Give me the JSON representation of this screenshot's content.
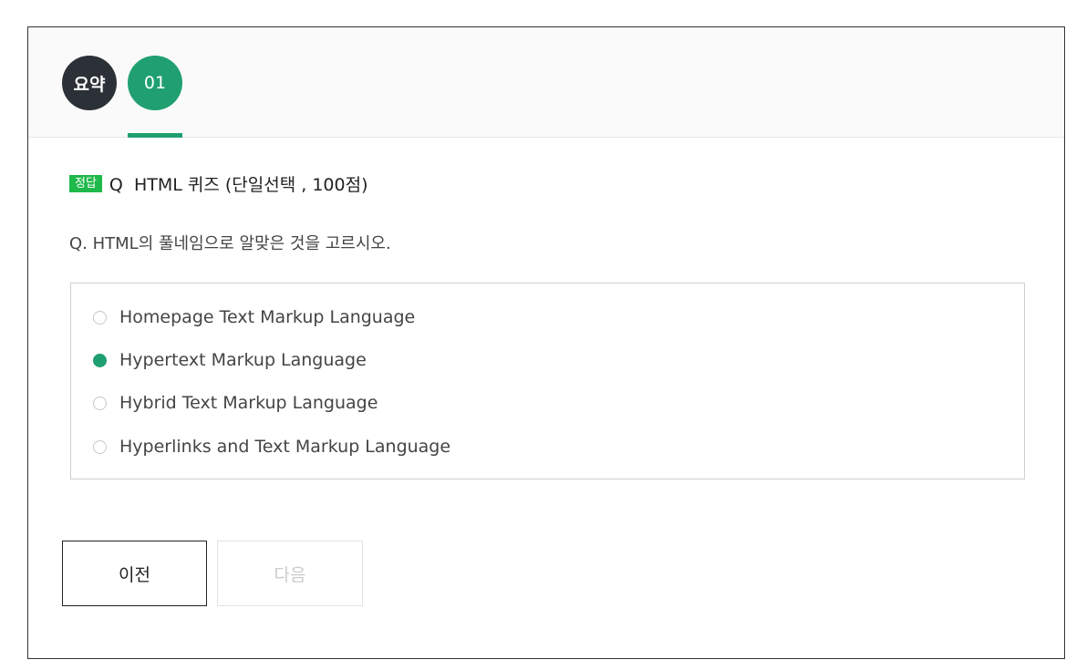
{
  "tabs": {
    "summary_label": "요약",
    "question_label": "01"
  },
  "question": {
    "badge": "정답",
    "title": "Q  HTML 퀴즈 (단일선택 , 100점)",
    "text": "Q. HTML의 풀네임으로 알맞은 것을 고르시오.",
    "options": [
      {
        "label": "Homepage Text Markup Language",
        "selected": false
      },
      {
        "label": "Hypertext Markup Language",
        "selected": true
      },
      {
        "label": "Hybrid Text Markup Language",
        "selected": false
      },
      {
        "label": "Hyperlinks and Text Markup Language",
        "selected": false
      }
    ]
  },
  "nav": {
    "prev_label": "이전",
    "next_label": "다음"
  },
  "colors": {
    "accent": "#20a070",
    "badge": "#1fb84a",
    "summary_tab": "#2c3137"
  }
}
